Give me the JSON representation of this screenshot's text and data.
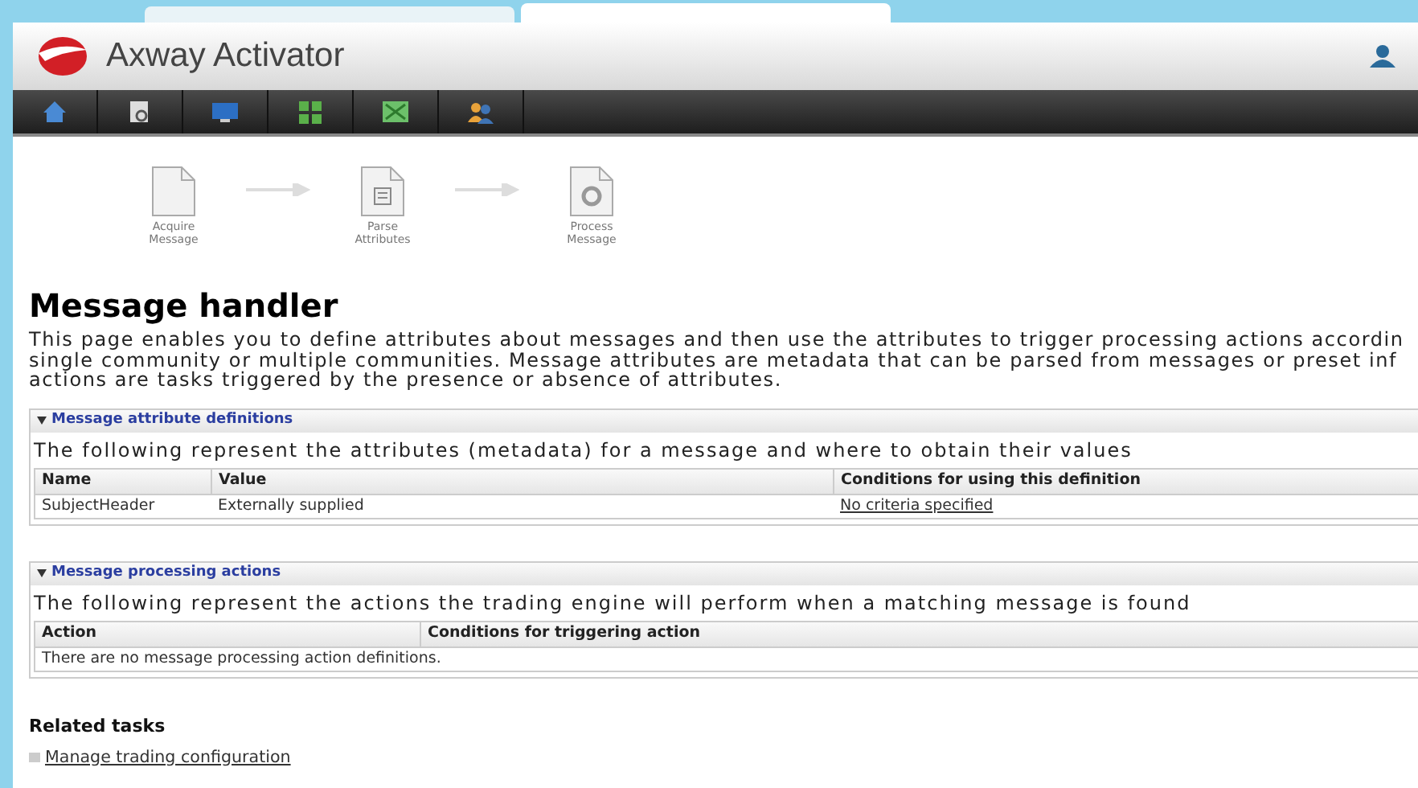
{
  "app": {
    "title": "Axway Activator"
  },
  "nav": [
    {
      "kind": "home"
    },
    {
      "kind": "search"
    },
    {
      "kind": "monitor"
    },
    {
      "kind": "grid"
    },
    {
      "kind": "map"
    },
    {
      "kind": "users"
    }
  ],
  "workflow": [
    {
      "label": "Acquire\nMessage",
      "kind": "blank"
    },
    {
      "label": "Parse\nAttributes",
      "kind": "list"
    },
    {
      "label": "Process\nMessage",
      "kind": "gear"
    }
  ],
  "page": {
    "heading": "Message handler",
    "description": [
      "This page enables you to define attributes about messages and then use the attributes to trigger processing actions accordin",
      "single community or multiple communities. Message attributes are metadata that can be parsed from messages or preset inf",
      "actions are tasks triggered by the presence or absence of attributes."
    ]
  },
  "sections": [
    {
      "title": "Message attribute definitions",
      "expanded": true,
      "intro": "The following represent the attributes (metadata) for a message and where to obtain their values",
      "columns": [
        "Name",
        "Value",
        "Conditions for using this definition"
      ],
      "rows": [
        [
          {
            "text": "SubjectHeader"
          },
          {
            "text": "Externally supplied"
          },
          {
            "text": "No criteria specified",
            "link": true
          }
        ]
      ]
    },
    {
      "title": "Message processing actions",
      "expanded": true,
      "intro": "The following represent the actions the trading engine will perform when a matching message is found",
      "columns": [
        "Action",
        "Conditions for triggering action"
      ],
      "empty": "There are no message processing action definitions."
    }
  ],
  "related": {
    "heading": "Related tasks",
    "links": [
      "Manage trading configuration"
    ]
  }
}
